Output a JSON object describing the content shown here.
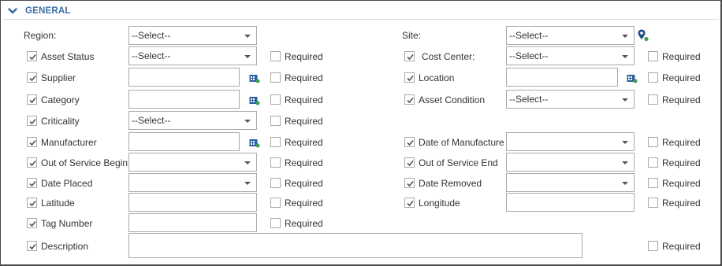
{
  "section": {
    "title": "GENERAL"
  },
  "required_label": "Required",
  "select_placeholder": "--Select--",
  "colors": {
    "accent": "#3a6ea5",
    "border": "#a9a9a9",
    "icon_blue": "#2b5f9e",
    "icon_green": "#3aa14a"
  },
  "icons": {
    "collapse": "chevron-down-icon",
    "picker": "lookup-list-icon",
    "map": "map-pin-icon"
  },
  "fields": {
    "region": {
      "label": "Region:",
      "value": "--Select--"
    },
    "site": {
      "label": "Site:",
      "value": "--Select--"
    },
    "asset_status": {
      "label": "Asset Status",
      "value": "--Select--",
      "checked": true
    },
    "cost_center": {
      "label": "Cost Center:",
      "value": "--Select--",
      "checked": true
    },
    "supplier": {
      "label": "Supplier",
      "value": "",
      "checked": true
    },
    "location": {
      "label": "Location",
      "value": "",
      "checked": true
    },
    "category": {
      "label": "Category",
      "value": "",
      "checked": true
    },
    "asset_condition": {
      "label": "Asset Condition",
      "value": "--Select--",
      "checked": true
    },
    "criticality": {
      "label": "Criticality",
      "value": "--Select--",
      "checked": true
    },
    "manufacturer": {
      "label": "Manufacturer",
      "value": "",
      "checked": true
    },
    "date_of_manufacture": {
      "label": "Date of Manufacture",
      "value": "",
      "checked": true
    },
    "out_of_service_begin": {
      "label": "Out of Service Begin",
      "value": "",
      "checked": true
    },
    "out_of_service_end": {
      "label": "Out of Service End",
      "value": "",
      "checked": true
    },
    "date_placed": {
      "label": "Date Placed",
      "value": "",
      "checked": true
    },
    "date_removed": {
      "label": "Date Removed",
      "value": "",
      "checked": true
    },
    "latitude": {
      "label": "Latitude",
      "value": "",
      "checked": true
    },
    "longitude": {
      "label": "Longitude",
      "value": "",
      "checked": true
    },
    "tag_number": {
      "label": "Tag Number",
      "value": "",
      "checked": true
    },
    "description": {
      "label": "Description",
      "value": "",
      "checked": true
    }
  }
}
